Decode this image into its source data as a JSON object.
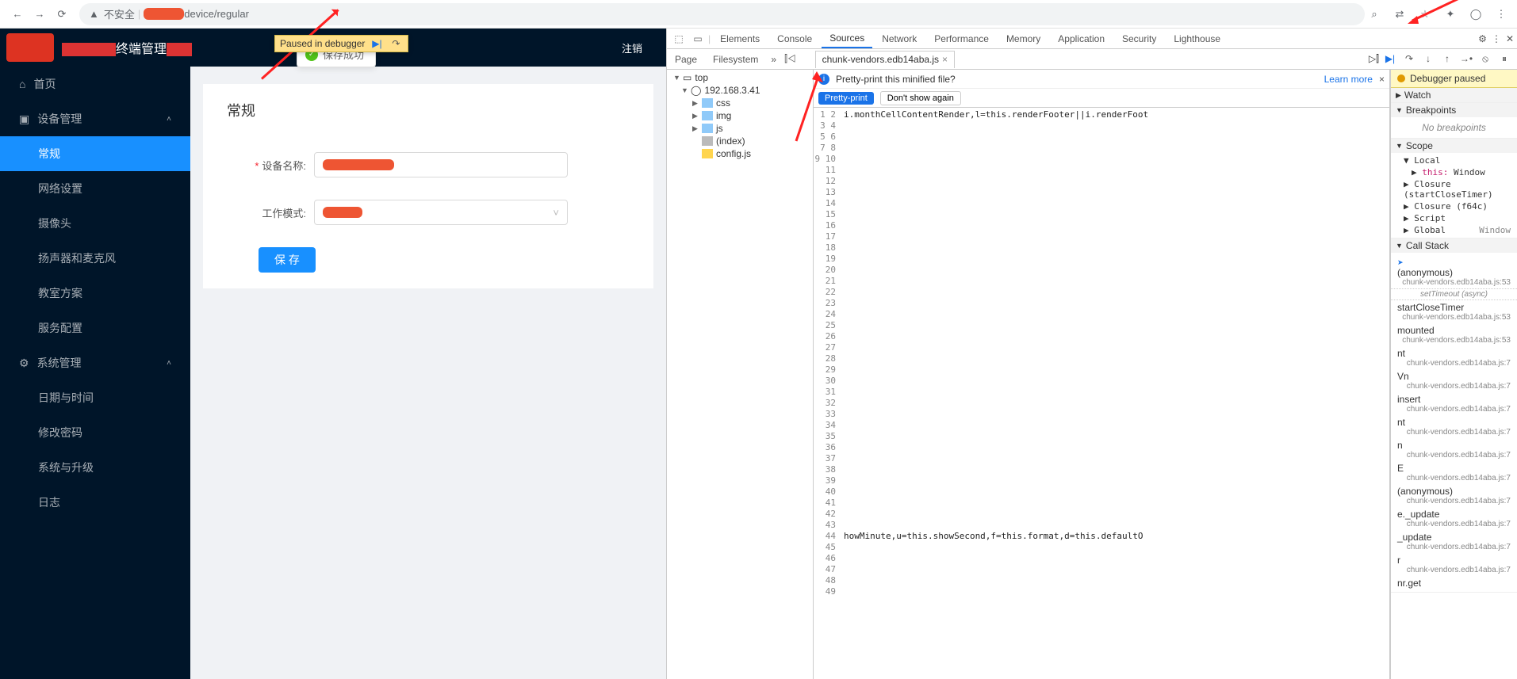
{
  "chrome": {
    "insecure_label": "不安全",
    "url_partial": "device/regular"
  },
  "debugger_badge": "Paused in debugger",
  "toast": "保存成功",
  "app": {
    "title": "终端管理",
    "logout": "注销",
    "sidebar": {
      "home": "首页",
      "device_mgmt": "设备管理",
      "regular": "常规",
      "network": "网络设置",
      "camera": "摄像头",
      "audio": "扬声器和麦克风",
      "classroom": "教室方案",
      "service": "服务配置",
      "system_mgmt": "系统管理",
      "datetime": "日期与时间",
      "password": "修改密码",
      "upgrade": "系统与升级",
      "log": "日志"
    },
    "form": {
      "title": "常规",
      "device_name_label": "设备名称:",
      "work_mode_label": "工作模式:",
      "save": "保 存"
    }
  },
  "devtools": {
    "tabs": [
      "Elements",
      "Console",
      "Sources",
      "Network",
      "Performance",
      "Memory",
      "Application",
      "Security",
      "Lighthouse"
    ],
    "active_tab": "Sources",
    "subtabs": {
      "page": "Page",
      "filesystem": "Filesystem"
    },
    "open_file": "chunk-vendors.edb14aba.js",
    "pretty_msg": "Pretty-print this minified file?",
    "pretty_btn": "Pretty-print",
    "dont_show": "Don't show again",
    "learn_more": "Learn more",
    "filetree": {
      "top": "top",
      "host": "192.168.3.41",
      "css": "css",
      "img": "img",
      "js": "js",
      "index": "(index)",
      "config": "config.js"
    },
    "code_line1": "i.monthCellContentRender,l=this.renderFooter||i.renderFoot",
    "code_line39": "howMinute,u=this.showSecond,f=this.format,d=this.defaultO",
    "debugger": {
      "paused_label": "Debugger paused",
      "watch": "Watch",
      "breakpoints": "Breakpoints",
      "no_breakpoints": "No breakpoints",
      "scope": "Scope",
      "local": "Local",
      "this_label": "this:",
      "this_val": "Window",
      "closure1": "Closure (startCloseTimer)",
      "closure2": "Closure (f64c)",
      "script": "Script",
      "global": "Global",
      "global_val": "Window",
      "callstack": "Call Stack",
      "async": "setTimeout (async)",
      "frames": [
        {
          "fn": "(anonymous)",
          "src": "chunk-vendors.edb14aba.js:53",
          "cur": true
        },
        {
          "fn": "startCloseTimer",
          "src": "chunk-vendors.edb14aba.js:53"
        },
        {
          "fn": "mounted",
          "src": "chunk-vendors.edb14aba.js:53"
        },
        {
          "fn": "nt",
          "src": "chunk-vendors.edb14aba.js:7"
        },
        {
          "fn": "Vn",
          "src": "chunk-vendors.edb14aba.js:7"
        },
        {
          "fn": "insert",
          "src": "chunk-vendors.edb14aba.js:7"
        },
        {
          "fn": "nt",
          "src": "chunk-vendors.edb14aba.js:7"
        },
        {
          "fn": "n",
          "src": "chunk-vendors.edb14aba.js:7"
        },
        {
          "fn": "E",
          "src": "chunk-vendors.edb14aba.js:7"
        },
        {
          "fn": "(anonymous)",
          "src": "chunk-vendors.edb14aba.js:7"
        },
        {
          "fn": "e._update",
          "src": "chunk-vendors.edb14aba.js:7"
        },
        {
          "fn": "_update",
          "src": "chunk-vendors.edb14aba.js:7"
        },
        {
          "fn": "r",
          "src": "chunk-vendors.edb14aba.js:7"
        },
        {
          "fn": "nr.get",
          "src": ""
        }
      ]
    }
  }
}
